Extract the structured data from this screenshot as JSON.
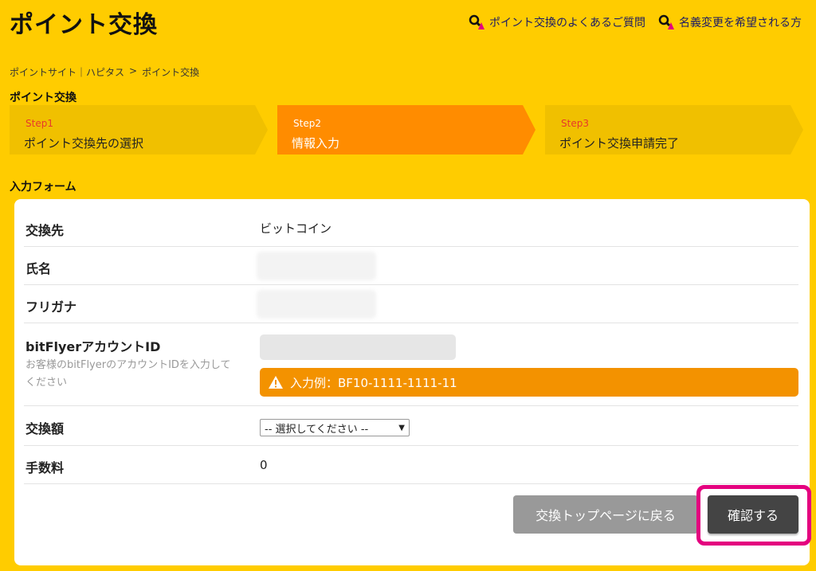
{
  "header": {
    "title": "ポイント交換",
    "links": [
      {
        "label": "ポイント交換のよくあるご質問",
        "icon": "magnifier-icon"
      },
      {
        "label": "名義変更を希望される方",
        "icon": "magnifier-icon"
      }
    ]
  },
  "breadcrumb": {
    "home": "ポイントサイト｜ハピタス",
    "separator": ">",
    "current": "ポイント交換"
  },
  "steps_section": {
    "title": "ポイント交換",
    "steps": [
      {
        "num": "Step1",
        "label": "ポイント交換先の選択"
      },
      {
        "num": "Step2",
        "label": "情報入力"
      },
      {
        "num": "Step3",
        "label": "ポイント交換申請完了"
      }
    ],
    "active_index": 1
  },
  "form": {
    "title": "入力フォーム",
    "rows": {
      "destination": {
        "label": "交換先",
        "value": "ビットコイン"
      },
      "name": {
        "label": "氏名"
      },
      "furigana": {
        "label": "フリガナ"
      },
      "account_id": {
        "label": "bitFlyerアカウントID",
        "hint": "お客様のbitFlyerのアカウントIDを入力してください",
        "input_value": "",
        "warning": "入力例：BF10-1111-1111-11"
      },
      "amount": {
        "label": "交換額",
        "selected": "-- 選択してください --"
      },
      "fee": {
        "label": "手数料",
        "value": "0"
      }
    },
    "buttons": {
      "back": "交換トップページに戻る",
      "confirm": "確認する"
    }
  },
  "colors": {
    "background": "#ffcc00",
    "step_inactive": "#f0c000",
    "step_active": "#ff8c00",
    "warning": "#f39200",
    "highlight": "#e4007f"
  }
}
